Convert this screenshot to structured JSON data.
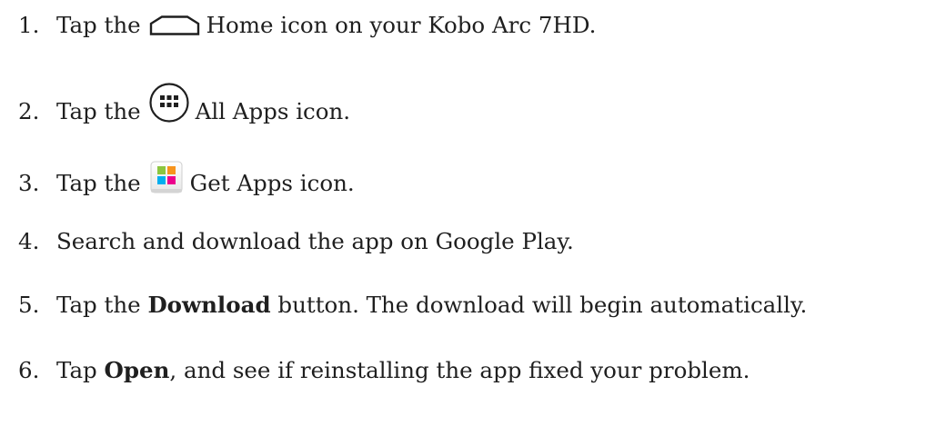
{
  "steps": [
    {
      "num": "1.",
      "before": "Tap the",
      "icon": "home-icon",
      "after": "Home icon on your Kobo Arc 7HD."
    },
    {
      "num": "2.",
      "before": "Tap the",
      "icon": "all-apps-icon",
      "after": "All Apps icon."
    },
    {
      "num": "3.",
      "before": "Tap the",
      "icon": "get-apps-icon",
      "after": "Get Apps icon."
    },
    {
      "num": "4.",
      "text": "Search and download the app on Google Play."
    },
    {
      "num": "5.",
      "before": "Tap the",
      "bold": "Download",
      "after": "button. The download will begin automatically."
    },
    {
      "num": "6.",
      "before": "Tap",
      "bold": "Open",
      "after": ", and see if reinstalling the app fixed your problem."
    }
  ],
  "colors": {
    "text": "#1f1f1f",
    "tile_green": "#8cc63f",
    "tile_orange": "#f7941d",
    "tile_cyan": "#00aeef",
    "tile_magenta": "#ec008c"
  }
}
